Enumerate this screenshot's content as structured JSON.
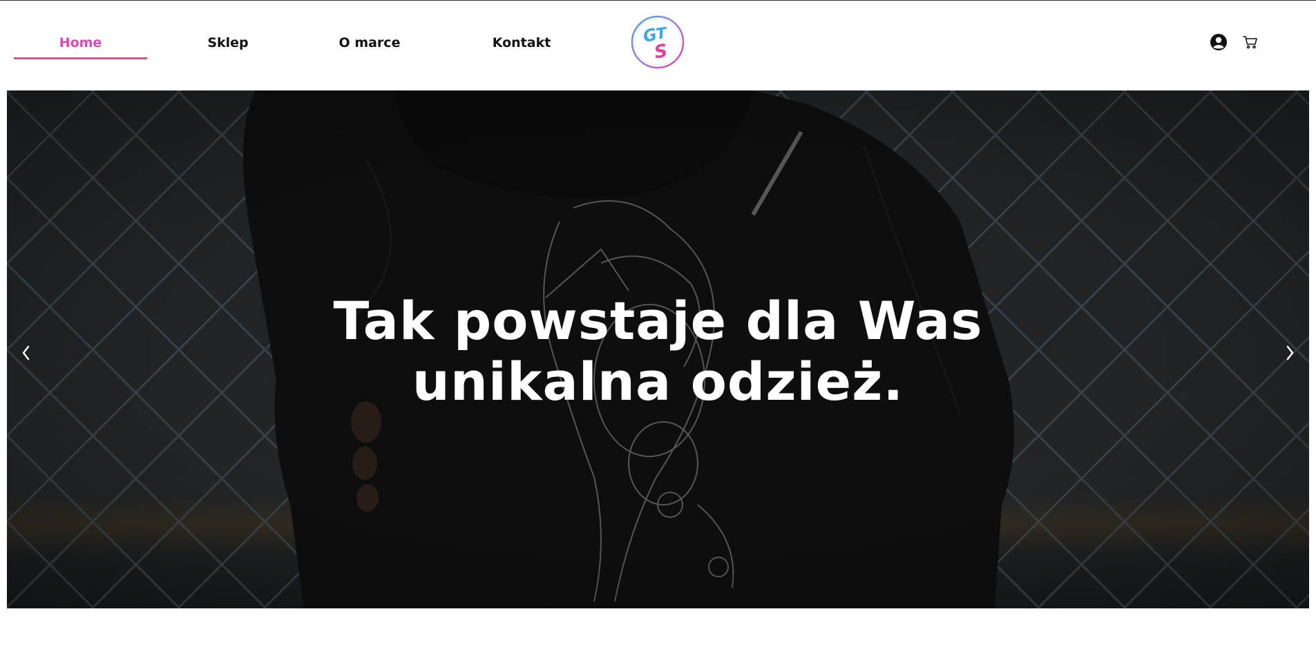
{
  "nav": {
    "items": [
      {
        "label": "Home",
        "active": true
      },
      {
        "label": "Sklep",
        "active": false
      },
      {
        "label": "O marce",
        "active": false
      },
      {
        "label": "Kontakt",
        "active": false
      }
    ]
  },
  "logo": {
    "text": "GTS"
  },
  "header_icons": [
    "account-icon",
    "cart-icon"
  ],
  "hero": {
    "title_line1": "Tak powstaje dla Was",
    "title_line2": "unikalna odzież.",
    "prev_icon": "chevron-left-icon",
    "next_icon": "chevron-right-icon"
  },
  "colors": {
    "accent": "#d94bb3",
    "logo_blue": "#3aa6e6",
    "logo_pink": "#e23fa0",
    "hero_overlay": "#1c1c1c",
    "hero_text": "#ffffff"
  }
}
